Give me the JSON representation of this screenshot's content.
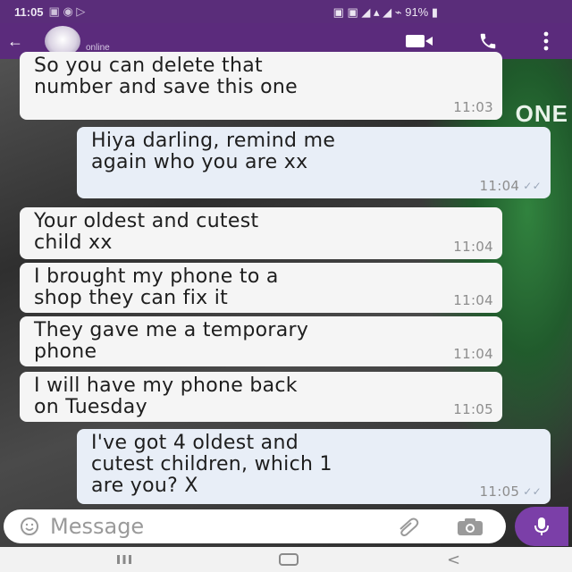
{
  "status_bar": {
    "time": "11:05",
    "icons": "▣ ◉ ▷",
    "battery": "▣ ▣ ◢ ▴ ◢ ⌁ 91% ▮"
  },
  "header": {
    "contact_status": "online"
  },
  "messages": [
    {
      "direction": "in",
      "text": "So you can delete that\nnumber and save this one",
      "time": "11:03",
      "ticks": ""
    },
    {
      "direction": "out",
      "text": "Hiya darling, remind me\nagain who you are xx",
      "time": "11:04",
      "ticks": "✓✓"
    },
    {
      "direction": "in",
      "text": "Your oldest and cutest\nchild xx",
      "time": "11:04",
      "ticks": ""
    },
    {
      "direction": "in",
      "text": "I brought my phone to a\nshop they can fix it",
      "time": "11:04",
      "ticks": ""
    },
    {
      "direction": "in",
      "text": "They gave me a temporary\nphone",
      "time": "11:04",
      "ticks": ""
    },
    {
      "direction": "in",
      "text": "I will have my phone back\non Tuesday",
      "time": "11:05",
      "ticks": ""
    },
    {
      "direction": "out",
      "text": "I've got 4 oldest and\ncutest children, which 1\nare you? X",
      "time": "11:05",
      "ticks": "✓✓"
    }
  ],
  "composer": {
    "placeholder": "Message"
  },
  "wallpaper": {
    "text": "ONE"
  },
  "colors": {
    "header": "#5b2b7c",
    "accent": "#7b3fa8",
    "incoming": "#f5f5f5",
    "outgoing": "#e8eef7"
  }
}
